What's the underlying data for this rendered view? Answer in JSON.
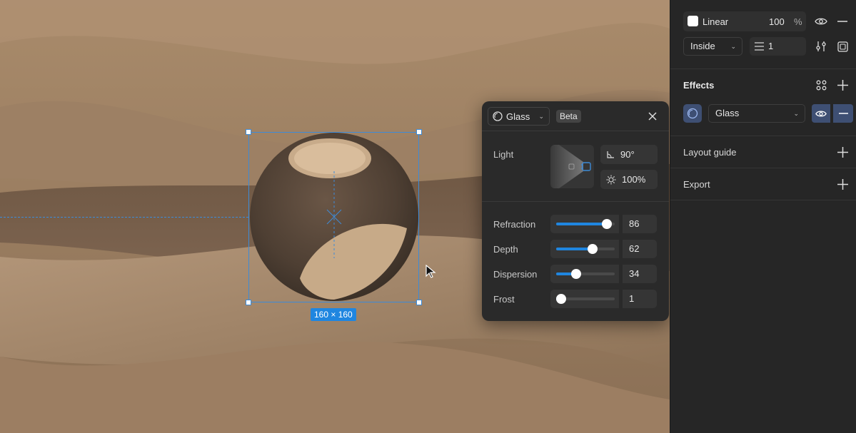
{
  "canvas": {
    "selection_size": "160 × 160"
  },
  "glass_popover": {
    "effect_name": "Glass",
    "beta_label": "Beta",
    "light_label": "Light",
    "light_angle": "90°",
    "light_intensity": "100%",
    "sliders": [
      {
        "label": "Refraction",
        "value": "86",
        "level": 0.86
      },
      {
        "label": "Depth",
        "value": "62",
        "level": 0.62
      },
      {
        "label": "Dispersion",
        "value": "34",
        "level": 0.34
      },
      {
        "label": "Frost",
        "value": "1",
        "level": 0.01
      }
    ]
  },
  "panel": {
    "fill": {
      "type": "Linear",
      "opacity": "100",
      "unit": "%",
      "swatch_color": "#ffffff"
    },
    "stroke": {
      "position": "Inside",
      "weight": "1"
    },
    "effects": {
      "title": "Effects",
      "effect": "Glass"
    },
    "layout_guide": "Layout guide",
    "export": "Export"
  },
  "colors": {
    "accent": "#1f86e0",
    "selection": "#3d8bd8",
    "chip": "#3e4f73"
  }
}
